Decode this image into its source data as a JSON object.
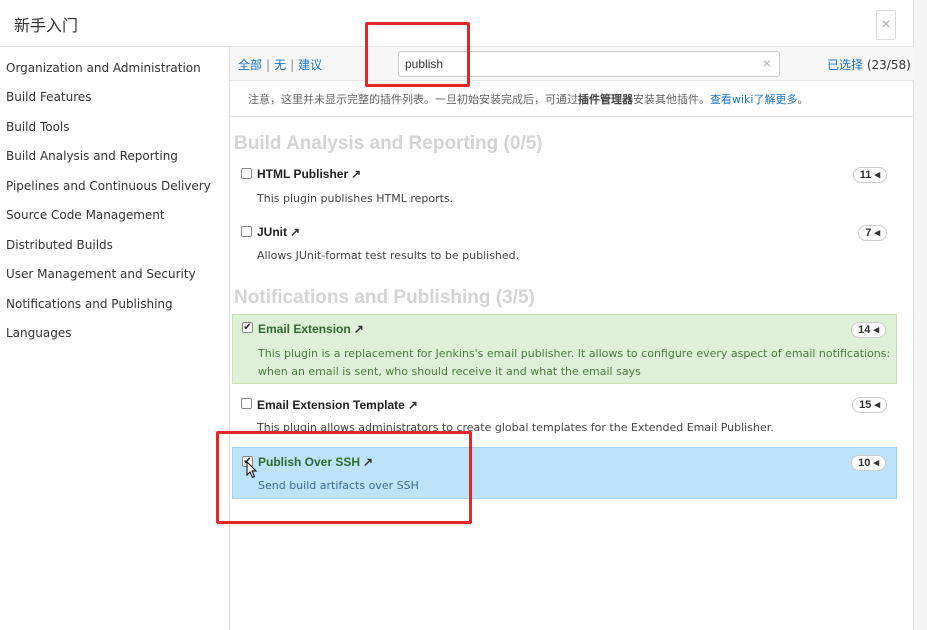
{
  "dialog": {
    "title": "新手入门",
    "close_label": "×"
  },
  "sidebar": {
    "items": [
      {
        "label": "Organization and Administration"
      },
      {
        "label": "Build Features"
      },
      {
        "label": "Build Tools"
      },
      {
        "label": "Build Analysis and Reporting"
      },
      {
        "label": "Pipelines and Continuous Delivery"
      },
      {
        "label": "Source Code Management"
      },
      {
        "label": "Distributed Builds"
      },
      {
        "label": "User Management and Security"
      },
      {
        "label": "Notifications and Publishing"
      },
      {
        "label": "Languages"
      }
    ]
  },
  "toolbar": {
    "filter_all": "全部",
    "filter_none": "无",
    "filter_suggested": "建议",
    "separator": "|",
    "search_value": "publish",
    "search_clear": "×",
    "selected_label": "已选择",
    "selected_count": "(23/58)"
  },
  "notice": {
    "text_before": "注意，这里并未显示完整的插件列表。一旦初始安装完成后，可通过",
    "bold": "插件管理器",
    "text_after": "安装其他插件。",
    "link": "查看wiki了解更多",
    "period": "。"
  },
  "groups": [
    {
      "title": "Build Analysis and Reporting (0/5)",
      "plugins": [
        {
          "name": "HTML Publisher",
          "desc": "This plugin publishes HTML reports.",
          "deps": "11",
          "checked": false
        },
        {
          "name": "JUnit",
          "desc": "Allows JUnit-format test results to be published.",
          "deps": "7",
          "checked": false
        }
      ]
    },
    {
      "title": "Notifications and Publishing (3/5)",
      "plugins": [
        {
          "name": "Email Extension",
          "desc": "This plugin is a replacement for Jenkins's email publisher. It allows to configure every aspect of email notifications: when an email is sent, who should receive it and what the email says",
          "deps": "14",
          "checked": true
        },
        {
          "name": "Email Extension Template",
          "desc": "This plugin allows administrators to create global templates for the Extended Email Publisher.",
          "deps": "15",
          "checked": false
        },
        {
          "name": "Publish Over SSH",
          "desc": "Send build artifacts over SSH",
          "deps": "10",
          "checked": true
        }
      ]
    }
  ],
  "icons": {
    "external_link": "↗",
    "check": "✔",
    "badge_arrow": "◂"
  },
  "colors": {
    "link": "#1a73c6",
    "selected_green": "#dff0d8",
    "selected_blue": "#bde3fb",
    "annotation_red": "#e3262b"
  }
}
